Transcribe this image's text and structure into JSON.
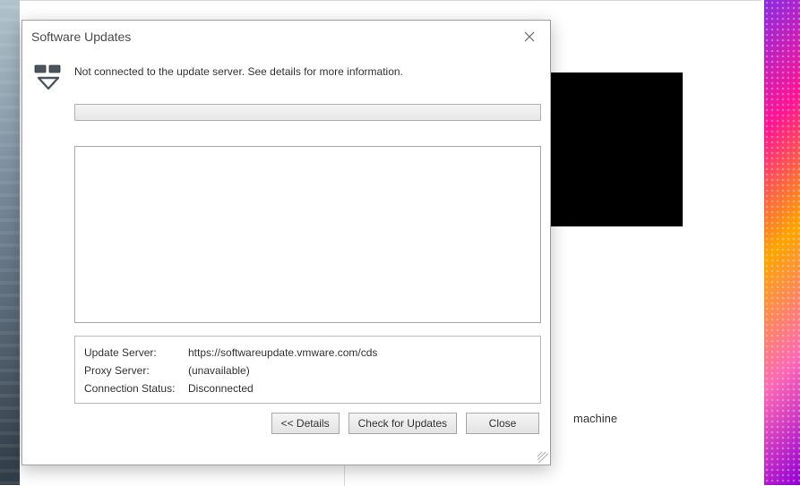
{
  "dialog": {
    "title": "Software Updates",
    "message": "Not connected to the update server. See details for more information.",
    "details": {
      "update_server": {
        "label": "Update Server:",
        "value": "https://softwareupdate.vmware.com/cds"
      },
      "proxy_server": {
        "label": "Proxy Server:",
        "value": "(unavailable)"
      },
      "conn_status": {
        "label": "Connection Status:",
        "value": "Disconnected"
      }
    },
    "buttons": {
      "details": "<< Details",
      "check": "Check for Updates",
      "close": "Close"
    }
  },
  "background": {
    "visible_text": "machine"
  }
}
